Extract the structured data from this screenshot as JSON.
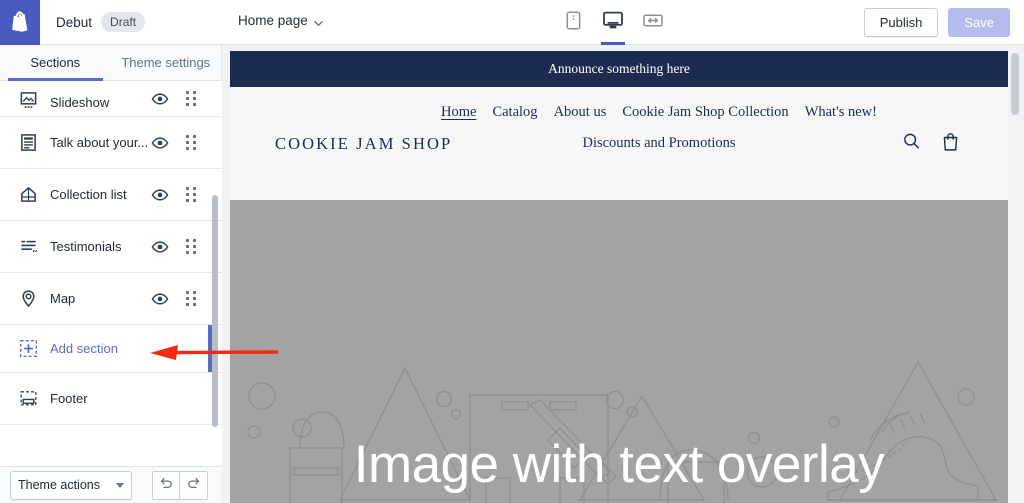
{
  "topbar": {
    "logo_icon": "shopify-bag-icon",
    "theme_name": "Debut",
    "status_badge": "Draft",
    "page_selector": "Home page",
    "chevron_icon": "chevron-down-icon",
    "devices": [
      {
        "name": "mobile-view",
        "icon": "mobile-icon",
        "active": false
      },
      {
        "name": "desktop-view",
        "icon": "desktop-icon",
        "active": true
      },
      {
        "name": "fullscreen-view",
        "icon": "fullscreen-icon",
        "active": false
      }
    ],
    "publish_label": "Publish",
    "save_label": "Save"
  },
  "sidebar": {
    "tabs": [
      {
        "label": "Sections",
        "active": true
      },
      {
        "label": "Theme settings",
        "active": false
      }
    ],
    "sections": [
      {
        "label": "Slideshow",
        "icon": "slideshow-icon"
      },
      {
        "label": "Talk about your...",
        "icon": "text-block-icon"
      },
      {
        "label": "Collection list",
        "icon": "collection-icon"
      },
      {
        "label": "Testimonials",
        "icon": "testimonials-icon"
      },
      {
        "label": "Map",
        "icon": "map-pin-icon"
      }
    ],
    "add_section": {
      "label": "Add section",
      "icon": "add-section-icon",
      "selected": true
    },
    "footer_section": {
      "label": "Footer",
      "icon": "footer-icon"
    },
    "eye_icon": "eye-icon",
    "drag_icon": "drag-handle-icon",
    "bottom": {
      "theme_actions_label": "Theme actions",
      "undo_icon": "undo-icon",
      "redo_icon": "redo-icon"
    }
  },
  "preview": {
    "announcement": "Announce something here",
    "store_name": "COOKIE JAM SHOP",
    "nav": [
      {
        "label": "Home",
        "current": true
      },
      {
        "label": "Catalog",
        "current": false
      },
      {
        "label": "About us",
        "current": false
      },
      {
        "label": "Cookie Jam Shop Collection",
        "current": false
      },
      {
        "label": "What's new!",
        "current": false
      },
      {
        "label": "Discounts and Promotions",
        "current": false
      }
    ],
    "search_icon": "search-icon",
    "cart_icon": "shopping-bag-icon",
    "hero_text": "Image with text overlay"
  },
  "annotation": {
    "arrow": "red-arrow-pointing-left",
    "color": "#f42a13"
  },
  "colors": {
    "brand_indigo": "#5c6ac4",
    "logo_tile": "#4959bd",
    "announce_bar": "#1c2b50",
    "hero_gray": "#a3a3a3",
    "save_disabled": "#b3bcec",
    "annotation_red": "#f42a13"
  }
}
